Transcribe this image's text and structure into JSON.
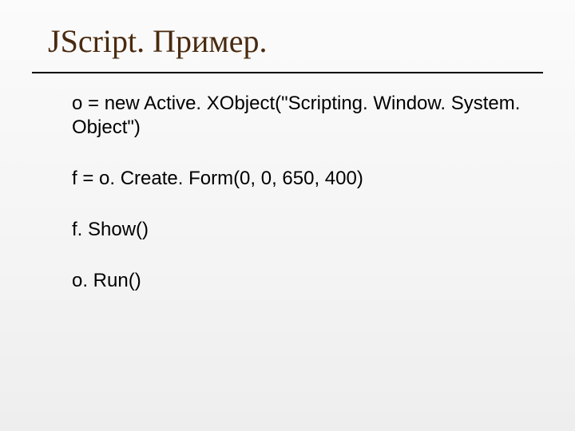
{
  "slide": {
    "title": "JScript. Пример.",
    "lines": {
      "l1": "o = new Active. XObject(\"Scripting. Window. System. Object\")",
      "l2": "f = o. Create. Form(0, 0, 650, 400)",
      "l3": "f. Show()",
      "l4": "o. Run()"
    }
  }
}
